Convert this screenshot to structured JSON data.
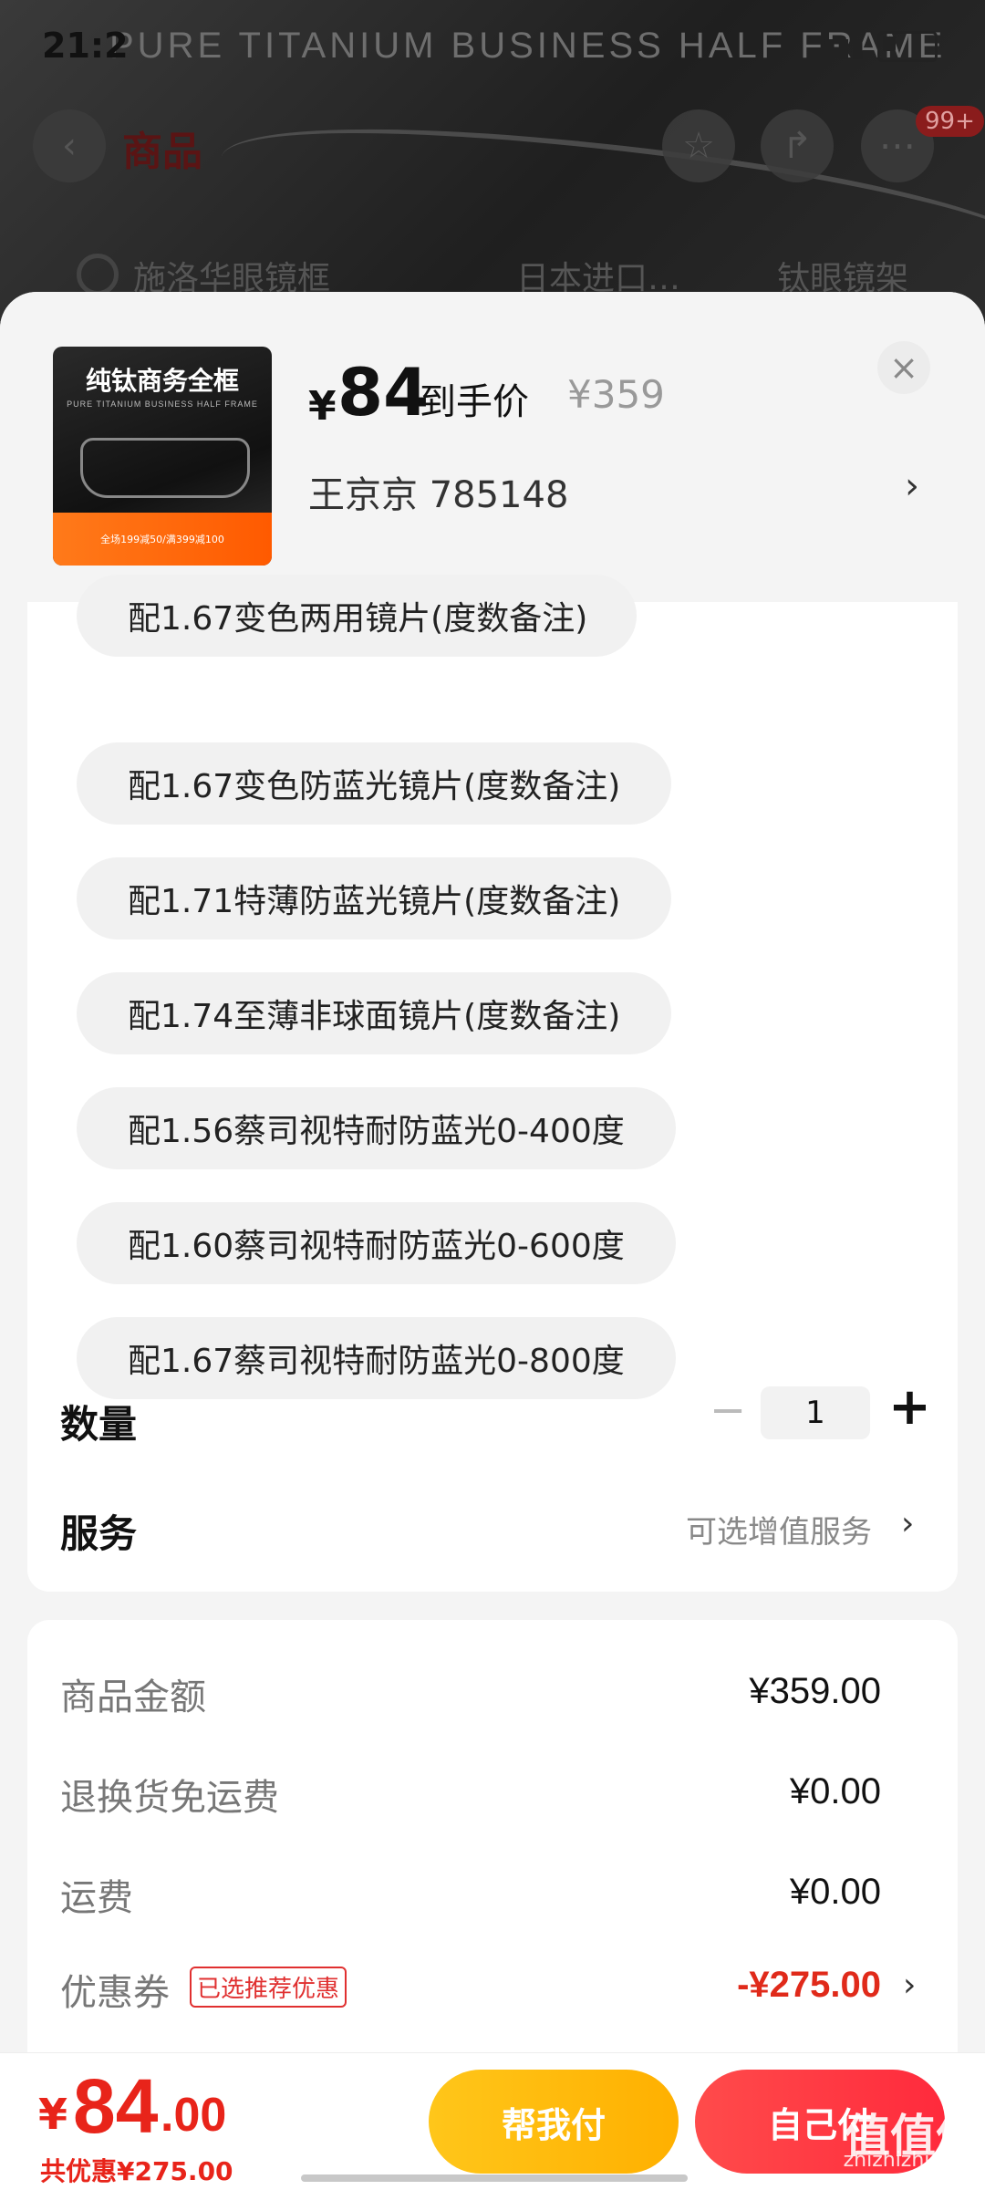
{
  "status_bar": {
    "time": "21:2",
    "right_text": ""
  },
  "background_page": {
    "banner": "PURE TITANIUM BUSINESS HALF FRAME",
    "title": "商品",
    "badge": "99+",
    "tabs": [
      "施洛华眼镜框",
      "日本进口…",
      "钛眼镜架"
    ]
  },
  "sheet": {
    "product": {
      "thumb_title": "纯钛商务全框",
      "thumb_subtitle": "PURE TITANIUM BUSINESS HALF FRAME",
      "thumb_promo": "全场199减50/满399减100",
      "currency": "¥",
      "price": "84",
      "price_label": "到手价",
      "original_price": "¥359",
      "variant_text": "王京京  785148"
    },
    "options": [
      "配1.67变色两用镜片(度数备注)",
      "配1.67变色防蓝光镜片(度数备注)",
      "配1.71特薄防蓝光镜片(度数备注)",
      "配1.74至薄非球面镜片(度数备注)",
      "配1.56蔡司视特耐防蓝光0-400度",
      "配1.60蔡司视特耐防蓝光0-600度",
      "配1.67蔡司视特耐防蓝光0-800度"
    ],
    "quantity": {
      "label": "数量",
      "value": "1",
      "minus": "−",
      "plus": "+"
    },
    "service": {
      "label": "服务",
      "value": "可选增值服务"
    },
    "summary": {
      "goods_amount_label": "商品金额",
      "goods_amount_value": "¥359.00",
      "return_label": "退换货免运费",
      "return_value": "¥0.00",
      "shipping_label": "运费",
      "shipping_value": "¥0.00",
      "coupon_label": "优惠券",
      "coupon_tag": "已选推荐优惠",
      "coupon_value": "-¥275.00"
    }
  },
  "bottom_bar": {
    "currency": "¥",
    "total_int": "84",
    "total_dec": ".00",
    "discount_text": "共优惠¥275.00",
    "help_pay_label": "帮我付",
    "self_pay_label": "自己付"
  },
  "watermark": {
    "big": "值值值",
    "small": "zhizhizhi.com"
  },
  "colors": {
    "accent_red": "#e8241a",
    "accent_yellow": "#ffb000"
  }
}
